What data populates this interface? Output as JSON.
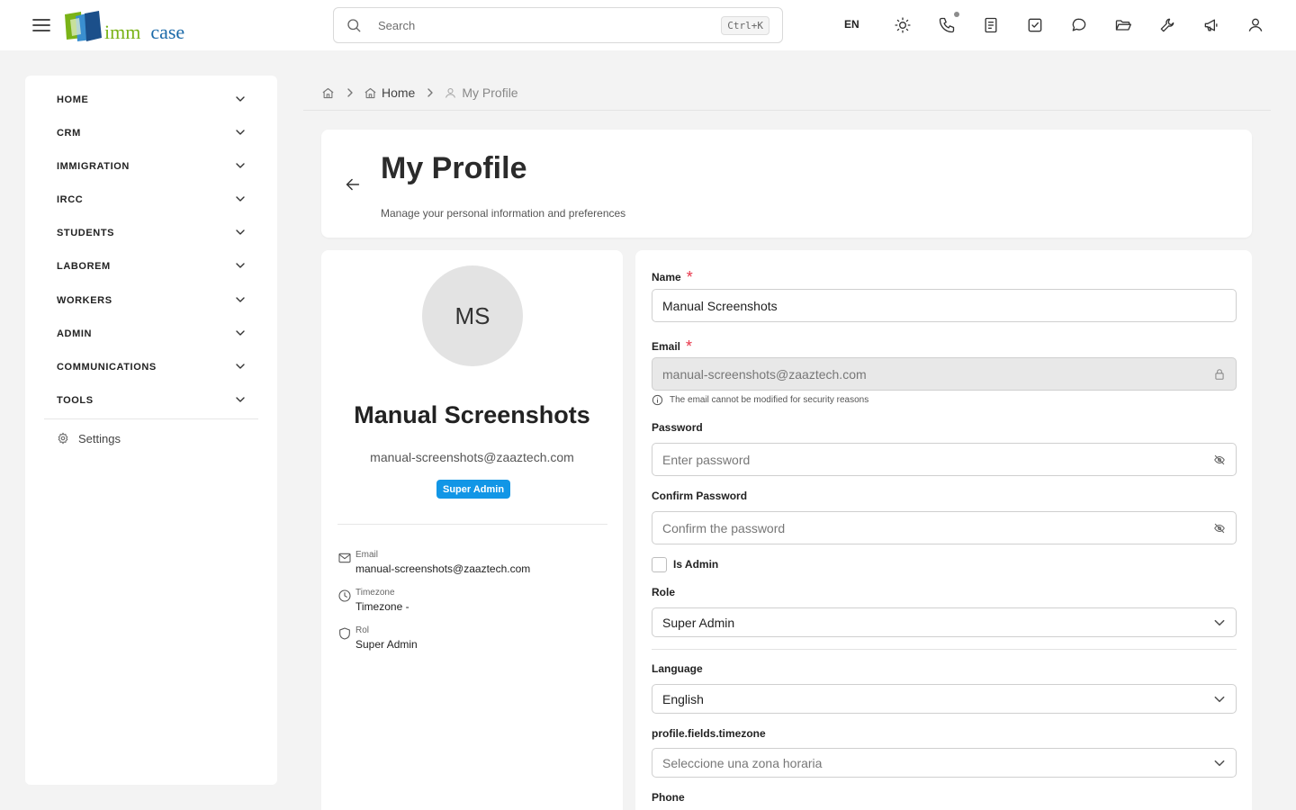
{
  "topbar": {
    "logo": {
      "word1": "imm",
      "word2": "case"
    },
    "search": {
      "placeholder": "Search",
      "shortcut": "Ctrl+K"
    },
    "language": "EN",
    "icons": [
      "sun-icon",
      "phone-icon",
      "notes-icon",
      "tasks-icon",
      "chat-icon",
      "folder-icon",
      "tools-icon",
      "megaphone-icon",
      "user-icon"
    ]
  },
  "sidebar": {
    "items": [
      {
        "label": "HOME"
      },
      {
        "label": "CRM"
      },
      {
        "label": "IMMIGRATION"
      },
      {
        "label": "IRCC"
      },
      {
        "label": "STUDENTS"
      },
      {
        "label": "LABOREM"
      },
      {
        "label": "WORKERS"
      },
      {
        "label": "ADMIN"
      },
      {
        "label": "COMMUNICATIONS"
      },
      {
        "label": "TOOLS"
      }
    ],
    "settings_label": "Settings"
  },
  "breadcrumb": {
    "home": "Home",
    "current": "My Profile"
  },
  "header": {
    "title": "My Profile",
    "subtitle": "Manage your personal information and preferences"
  },
  "profile": {
    "initials": "MS",
    "name": "Manual Screenshots",
    "email": "manual-screenshots@zaaztech.com",
    "badge": "Super Admin",
    "info": [
      {
        "label": "Email",
        "value": "manual-screenshots@zaaztech.com"
      },
      {
        "label": "Timezone",
        "value": "Timezone -"
      },
      {
        "label": "Rol",
        "value": "Super Admin"
      }
    ]
  },
  "form": {
    "name": {
      "label": "Name",
      "required": "*",
      "value": "Manual Screenshots"
    },
    "email": {
      "label": "Email",
      "required": "*",
      "value": "manual-screenshots@zaaztech.com",
      "hint": "The email cannot be modified for security reasons"
    },
    "password": {
      "label": "Password",
      "placeholder": "Enter password"
    },
    "confirm_password": {
      "label": "Confirm Password",
      "placeholder": "Confirm the password"
    },
    "is_admin": {
      "label": "Is Admin",
      "checked": false
    },
    "role": {
      "label": "Role",
      "value": "Super Admin"
    },
    "language": {
      "label": "Language",
      "value": "English"
    },
    "timezone": {
      "label": "profile.fields.timezone",
      "placeholder": "Seleccione una zona horaria"
    },
    "phone": {
      "label": "Phone"
    }
  },
  "colors": {
    "accent": "#1296e6",
    "required": "#e8364a",
    "logo_green": "#7ab317",
    "logo_blue": "#1b6aa9"
  }
}
